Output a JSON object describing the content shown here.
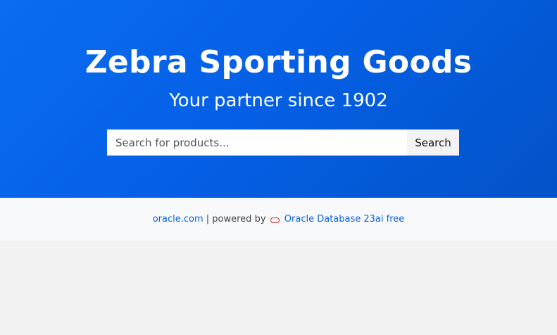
{
  "header": {
    "title": "Zebra Sporting Goods",
    "subtitle": "Your partner since 1902"
  },
  "search": {
    "placeholder": "Search for products...",
    "value": "",
    "button_label": "Search"
  },
  "footer": {
    "link_oracle": "oracle.com",
    "separator_text": " | powered by ",
    "db_icon": "oracle-logo-icon",
    "db_link": "Oracle Database 23ai free"
  },
  "colors": {
    "hero_start": "#0a6cf0",
    "hero_end": "#0352c8",
    "link": "#0a63e0",
    "oracle_red": "#d9261c"
  }
}
